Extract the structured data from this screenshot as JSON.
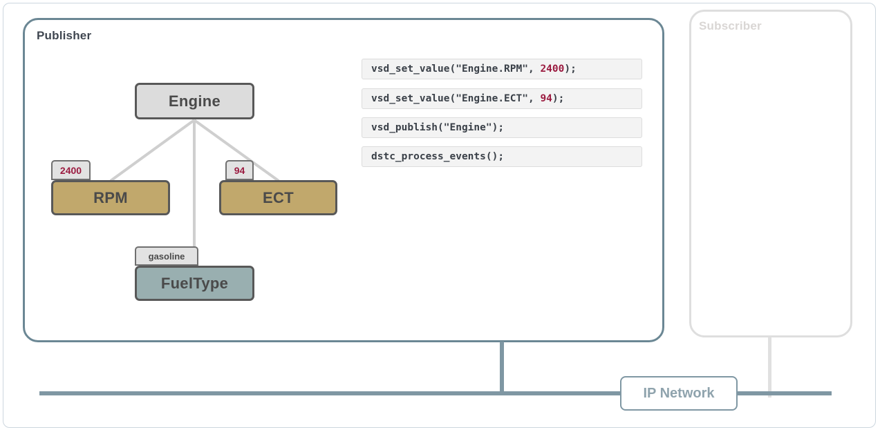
{
  "publisher": {
    "title": "Publisher",
    "root_node": {
      "label": "Engine"
    },
    "signals": [
      {
        "label": "RPM",
        "value": "2400",
        "value_type": "number"
      },
      {
        "label": "ECT",
        "value": "94",
        "value_type": "number"
      },
      {
        "label": "FuelType",
        "value": "gasoline",
        "value_type": "text"
      }
    ],
    "code_lines": [
      {
        "prefix": "vsd_set_value(\"Engine.RPM\", ",
        "value": "2400",
        "suffix": ");"
      },
      {
        "prefix": "vsd_set_value(\"Engine.ECT\", ",
        "value": "94",
        "suffix": ");"
      },
      {
        "prefix": "vsd_publish(\"Engine\");",
        "value": "",
        "suffix": ""
      },
      {
        "prefix": "dstc_process_events();",
        "value": "",
        "suffix": ""
      }
    ]
  },
  "subscriber": {
    "title": "Subscriber"
  },
  "network": {
    "label": "IP Network"
  },
  "colors": {
    "panel_border": "#6b8794",
    "panel_border_faded": "#dedede",
    "signal_fill": "#c1a86c",
    "enum_fill": "#99afb0",
    "root_fill": "#dcdcdc",
    "node_border": "#585858",
    "value_text": "#9b1b40",
    "bus": "#7f97a3",
    "bus_faded": "#e0e0e0",
    "code_bg": "#f3f3f3",
    "tree_line": "#cfcfcf"
  }
}
